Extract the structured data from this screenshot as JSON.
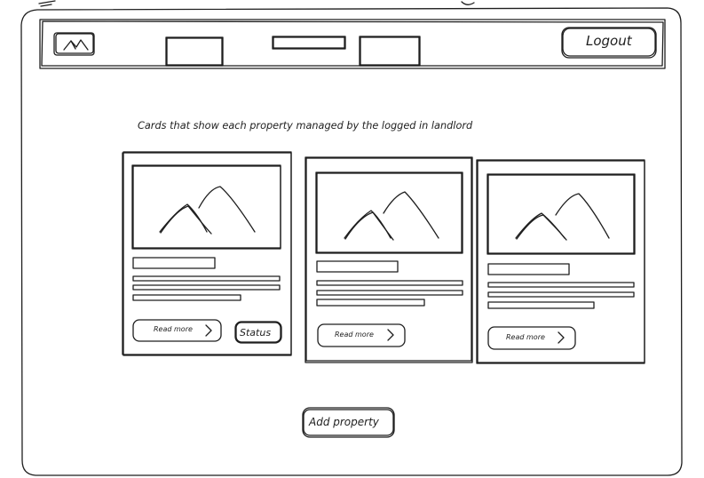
{
  "header": {
    "logout_label": "Logout"
  },
  "main": {
    "description": "Cards that show each property managed by the logged in landlord",
    "add_property_label": "Add property"
  },
  "cards": [
    {
      "read_more_label": "Read more",
      "status_label": "Status"
    },
    {
      "read_more_label": "Read more"
    },
    {
      "read_more_label": "Read more"
    }
  ],
  "icons": {
    "logo": "mountain-icon",
    "card_image": "image-placeholder-icon",
    "read_more": "chevron-right-icon"
  }
}
